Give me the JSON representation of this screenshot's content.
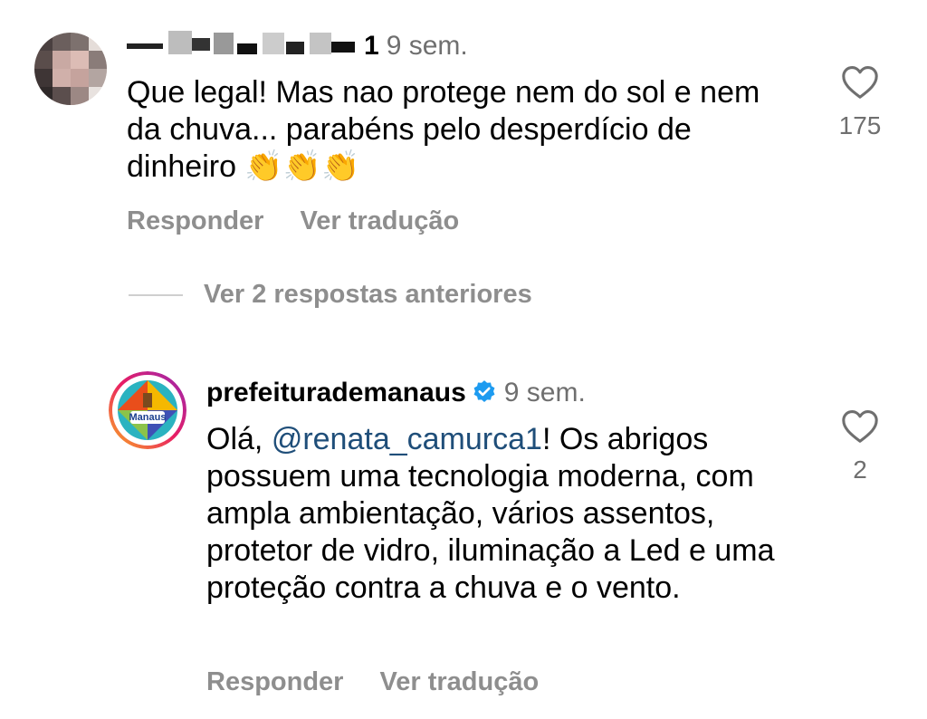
{
  "comments": [
    {
      "username": "renata_camurca1",
      "time": "9 sem.",
      "text": "Que legal! Mas nao protege nem do sol e nem da chuva... parabéns pelo desperdício de dinheiro 👏👏👏",
      "likes": "175",
      "reply_label": "Responder",
      "translate_label": "Ver tradução",
      "avatar_icon": "blurred-avatar"
    },
    {
      "username": "prefeiturademanaus",
      "time": "9 sem.",
      "mention": "@renata_camurca1",
      "text_prefix": "Olá, ",
      "text_rest": "! Os abrigos possuem uma tecnologia moderna, com ampla ambientação, vários assentos, protetor de vidro, iluminação a Led e uma proteção contra a chuva e o vento.",
      "likes": "2",
      "reply_label": "Responder",
      "translate_label": "Ver tradução",
      "avatar_text": "Manaus",
      "verified_icon": "verified-badge-icon"
    }
  ],
  "view_replies_label": "Ver 2 respostas anteriores",
  "colors": {
    "mention": "#1f4e79",
    "verified": "#1d9bf0",
    "muted": "#8e8e8e"
  }
}
